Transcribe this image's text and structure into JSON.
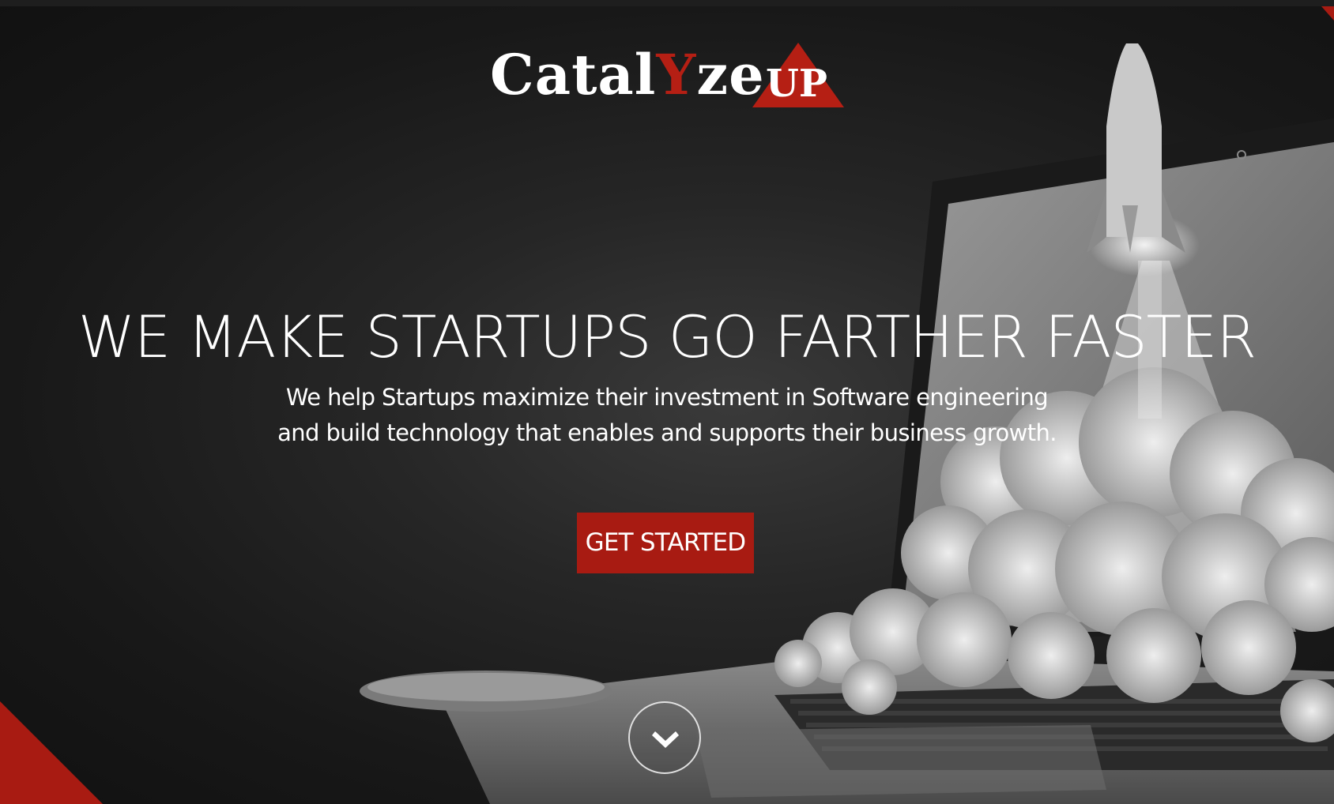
{
  "brand": {
    "logo_prefix": "Catal",
    "logo_accent": "Y",
    "logo_suffix": "ze",
    "logo_badge": "UP",
    "accent_color": "#b51f14"
  },
  "hero": {
    "headline": "WE MAKE STARTUPS GO FARTHER FASTER",
    "subline_1": "We help Startups maximize their investment in Software engineering",
    "subline_2": "and build technology that enables and supports their business growth.",
    "cta_label": "GET STARTED",
    "cta_color": "#a81b12",
    "scroll_icon": "chevron-down-icon",
    "background_image": "laptop-rocket-launch-illustration"
  }
}
